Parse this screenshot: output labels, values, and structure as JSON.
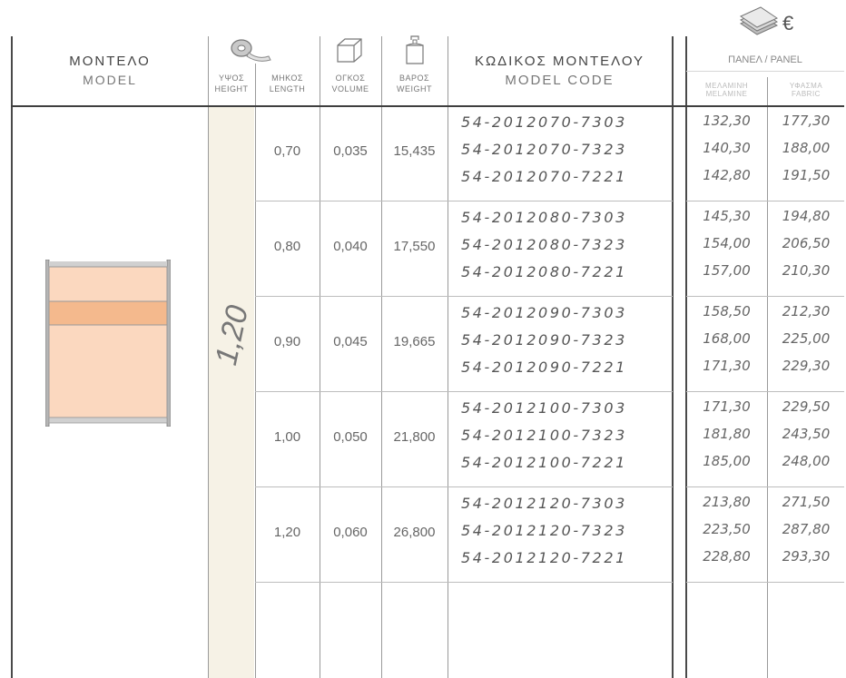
{
  "header": {
    "model_gr": "ΜΟΝΤΕΛΟ",
    "model_en": "MODEL",
    "height_gr": "ΥΨΟΣ",
    "height_en": "HEIGHT",
    "length_gr": "ΜΗΚΟΣ",
    "length_en": "LENGTH",
    "volume_gr": "ΟΓΚΟΣ",
    "volume_en": "VOLUME",
    "weight_gr": "ΒΑΡΟΣ",
    "weight_en": "WEIGHT",
    "code_gr": "ΚΩΔΙΚΟΣ ΜΟΝΤΕΛΟΥ",
    "code_en": "MODEL CODE",
    "currency": "€",
    "panel_label": "ΠΑΝΕΛ / PANEL",
    "melamine_gr": "ΜΕΛΑΜΙΝΗ",
    "melamine_en": "MELAMINE",
    "fabric_gr": "ΥΦΑΣΜΑ",
    "fabric_en": "FABRIC"
  },
  "icons": {
    "tape": "measuring-tape-icon",
    "cube": "cube-icon",
    "weight": "weight-icon",
    "money": "money-icon"
  },
  "colors": {
    "model_fill": "#fbd8bf",
    "model_band": "#f4b98d",
    "height_column": "#f6f2e6"
  },
  "height": "1,20",
  "groups": [
    {
      "length": "0,70",
      "volume": "0,035",
      "weight": "15,435",
      "rows": [
        {
          "code": "54-2012070-7303",
          "melamine": "132,30",
          "fabric": "177,30"
        },
        {
          "code": "54-2012070-7323",
          "melamine": "140,30",
          "fabric": "188,00"
        },
        {
          "code": "54-2012070-7221",
          "melamine": "142,80",
          "fabric": "191,50"
        }
      ]
    },
    {
      "length": "0,80",
      "volume": "0,040",
      "weight": "17,550",
      "rows": [
        {
          "code": "54-2012080-7303",
          "melamine": "145,30",
          "fabric": "194,80"
        },
        {
          "code": "54-2012080-7323",
          "melamine": "154,00",
          "fabric": "206,50"
        },
        {
          "code": "54-2012080-7221",
          "melamine": "157,00",
          "fabric": "210,30"
        }
      ]
    },
    {
      "length": "0,90",
      "volume": "0,045",
      "weight": "19,665",
      "rows": [
        {
          "code": "54-2012090-7303",
          "melamine": "158,50",
          "fabric": "212,30"
        },
        {
          "code": "54-2012090-7323",
          "melamine": "168,00",
          "fabric": "225,00"
        },
        {
          "code": "54-2012090-7221",
          "melamine": "171,30",
          "fabric": "229,30"
        }
      ]
    },
    {
      "length": "1,00",
      "volume": "0,050",
      "weight": "21,800",
      "rows": [
        {
          "code": "54-2012100-7303",
          "melamine": "171,30",
          "fabric": "229,50"
        },
        {
          "code": "54-2012100-7323",
          "melamine": "181,80",
          "fabric": "243,50"
        },
        {
          "code": "54-2012100-7221",
          "melamine": "185,00",
          "fabric": "248,00"
        }
      ]
    },
    {
      "length": "1,20",
      "volume": "0,060",
      "weight": "26,800",
      "rows": [
        {
          "code": "54-2012120-7303",
          "melamine": "213,80",
          "fabric": "271,50"
        },
        {
          "code": "54-2012120-7323",
          "melamine": "223,50",
          "fabric": "287,80"
        },
        {
          "code": "54-2012120-7221",
          "melamine": "228,80",
          "fabric": "293,30"
        }
      ]
    }
  ]
}
